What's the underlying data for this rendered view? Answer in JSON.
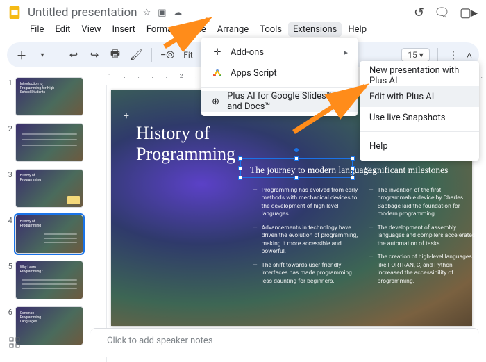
{
  "doc": {
    "title": "Untitled presentation"
  },
  "menubar": [
    "File",
    "Edit",
    "View",
    "Insert",
    "Format",
    "Slide",
    "Arrange",
    "Tools",
    "Extensions",
    "Help"
  ],
  "toolbar": {
    "fit_label": "Fit",
    "zoom_value": "15"
  },
  "thumbnails": [
    {
      "num": "1",
      "title": "Introduction to Programming for High School Students"
    },
    {
      "num": "2",
      "title": ""
    },
    {
      "num": "3",
      "title": "History of Programming"
    },
    {
      "num": "4",
      "title": "History of Programming",
      "selected": true
    },
    {
      "num": "5",
      "title": "Why Learn Programming?"
    },
    {
      "num": "6",
      "title": "Common Programming Languages"
    }
  ],
  "slide": {
    "title_line1": "History of",
    "title_line2": "Programming",
    "subhead1": "The journey to modern languages",
    "subhead2": "Significant milestones",
    "col1": [
      "Programming has evolved from early methods with mechanical devices to the development of high-level languages.",
      "Advancements in technology have driven the evolution of programming, making it more accessible and powerful.",
      "The shift towards user-friendly interfaces has made programming less daunting for beginners."
    ],
    "col2": [
      "The invention of the first programmable device by Charles Babbage laid the foundation for modern programming.",
      "The development of assembly languages and compilers accelerated the automation of tasks.",
      "The creation of high-level languages like FORTRAN, C, and Python increased the accessibility of programming."
    ]
  },
  "ext_menu": {
    "addons": "Add-ons",
    "apps_script": "Apps Script",
    "plus_ai": "Plus AI for Google Slides™ and Docs™"
  },
  "plus_submenu": {
    "new_pres": "New presentation with Plus AI",
    "edit": "Edit with Plus AI",
    "snapshots": "Use live Snapshots",
    "help": "Help"
  },
  "notes": {
    "placeholder": "Click to add speaker notes"
  },
  "ruler": "1 . . . . 2 . . . . 3 . . . . 4 . . . . 5 . . . . 6 . . . . 7 . . . . 8 . . . . 9 . . . . 10"
}
